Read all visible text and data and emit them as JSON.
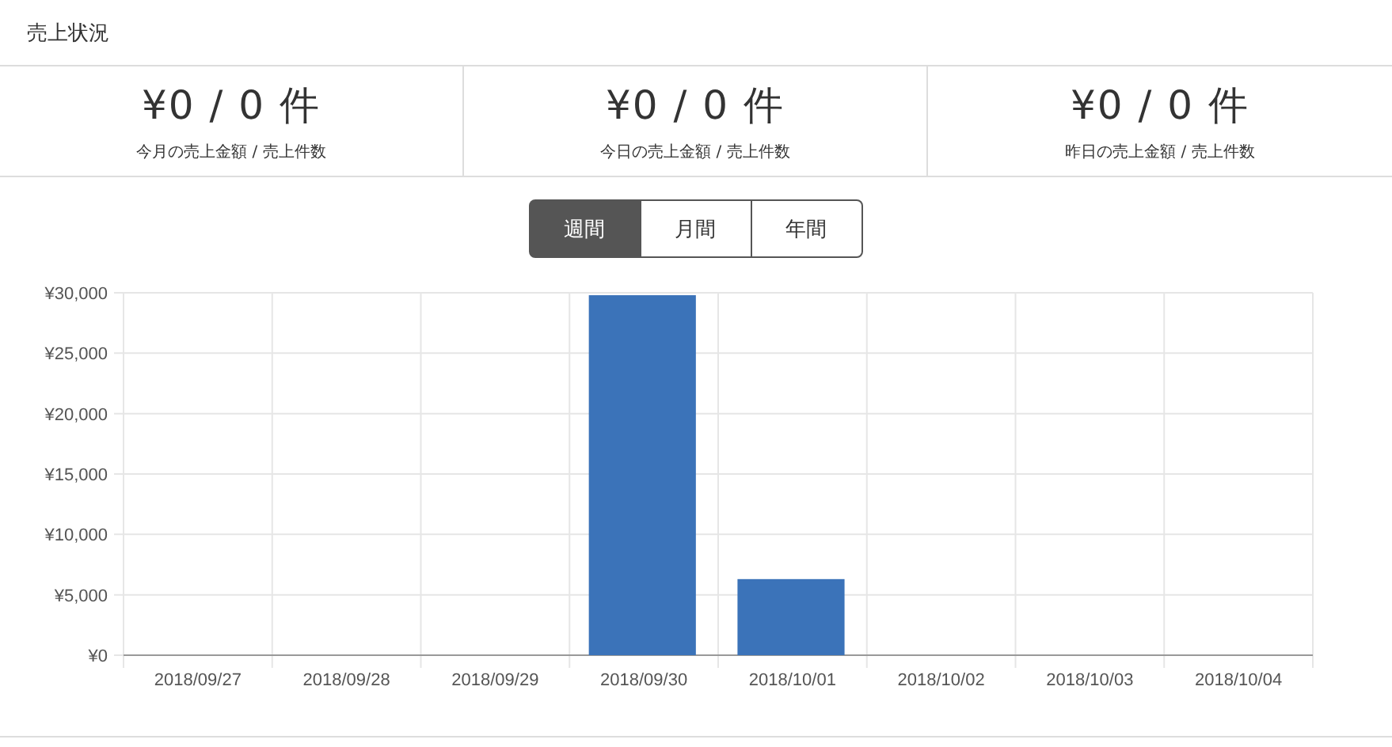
{
  "panel": {
    "title": "売上状況"
  },
  "stats": [
    {
      "value": "¥0 / 0 件",
      "label": "今月の売上金額 / 売上件数"
    },
    {
      "value": "¥0 / 0 件",
      "label": "今日の売上金額 / 売上件数"
    },
    {
      "value": "¥0 / 0 件",
      "label": "昨日の売上金額 / 売上件数"
    }
  ],
  "period_tabs": [
    {
      "label": "週間",
      "selected": true
    },
    {
      "label": "月間",
      "selected": false
    },
    {
      "label": "年間",
      "selected": false
    }
  ],
  "chart_data": {
    "type": "bar",
    "categories": [
      "2018/09/27",
      "2018/09/28",
      "2018/09/29",
      "2018/09/30",
      "2018/10/01",
      "2018/10/02",
      "2018/10/03",
      "2018/10/04"
    ],
    "grid": true,
    "series": [
      {
        "color": "#3b73b9",
        "values": [
          0,
          0,
          0,
          29800,
          6300,
          0,
          0,
          0
        ]
      }
    ],
    "ylim": [
      0,
      30000
    ],
    "yticks": [
      {
        "value": 0,
        "label": "¥0"
      },
      {
        "value": 5000,
        "label": "¥5,000"
      },
      {
        "value": 10000,
        "label": "¥10,000"
      },
      {
        "value": 15000,
        "label": "¥15,000"
      },
      {
        "value": 20000,
        "label": "¥20,000"
      },
      {
        "value": 25000,
        "label": "¥25,000"
      },
      {
        "value": 30000,
        "label": "¥30,000"
      }
    ]
  }
}
